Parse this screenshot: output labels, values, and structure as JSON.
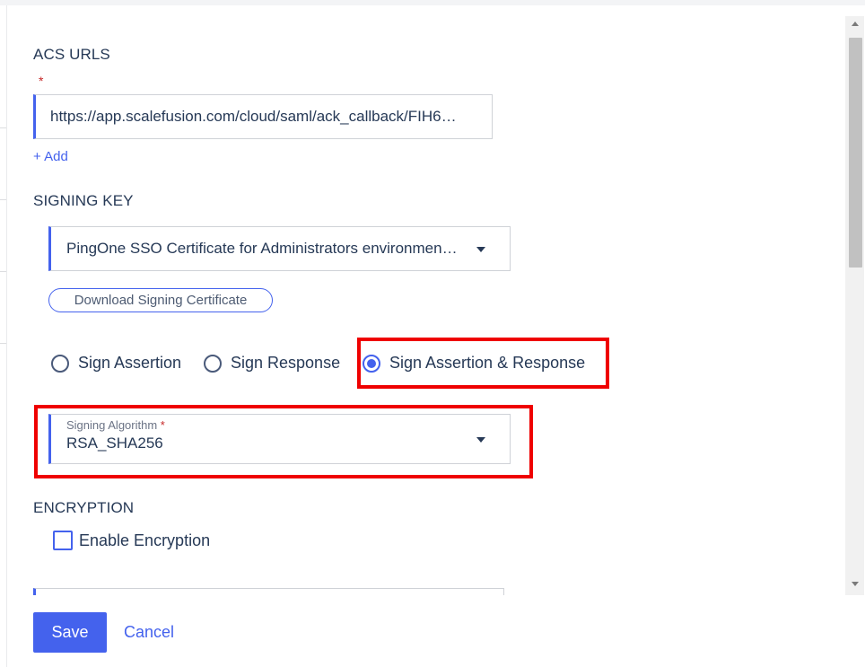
{
  "acs_urls": {
    "label": "ACS URLS",
    "required_marker": "*",
    "value": "https://app.scalefusion.com/cloud/saml/ack_callback/FIH6…",
    "add_label": "+ Add"
  },
  "signing_key": {
    "label": "SIGNING KEY",
    "selected": "PingOne SSO Certificate for Administrators environmen…",
    "download_button": "Download Signing Certificate"
  },
  "signing_options": {
    "options": [
      {
        "label": "Sign Assertion",
        "checked": false
      },
      {
        "label": "Sign Response",
        "checked": false
      },
      {
        "label": "Sign Assertion & Response",
        "checked": true
      }
    ]
  },
  "signing_algorithm": {
    "label": "Signing Algorithm",
    "required_marker": "*",
    "value": "RSA_SHA256"
  },
  "encryption": {
    "label": "ENCRYPTION",
    "checkbox_label": "Enable Encryption",
    "checked": false
  },
  "footer": {
    "save_label": "Save",
    "cancel_label": "Cancel"
  },
  "colors": {
    "accent": "#4462ed",
    "highlight": "#ef0000",
    "text": "#263956"
  }
}
